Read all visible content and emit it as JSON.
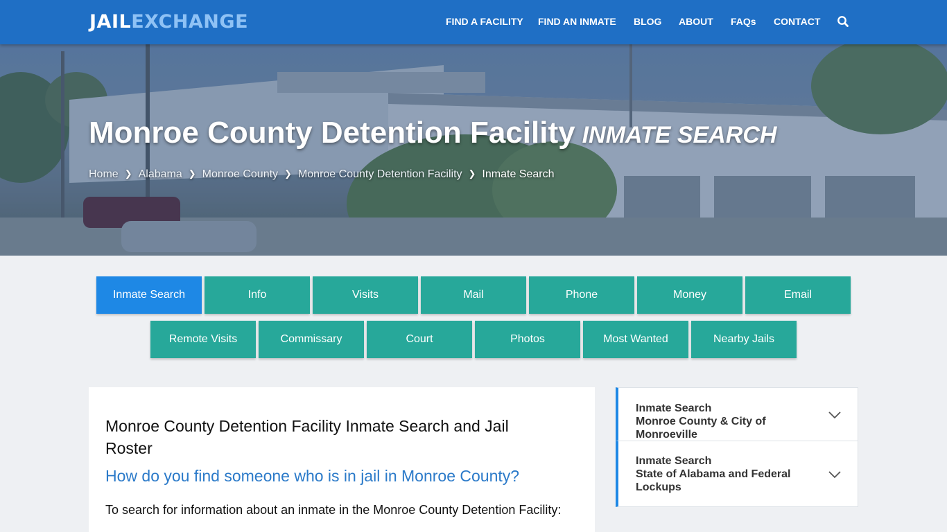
{
  "header": {
    "logo_part1": "JAIL",
    "logo_part2": "EXCHANGE",
    "nav": [
      "FIND A FACILITY",
      "FIND AN INMATE",
      "BLOG",
      "ABOUT",
      "FAQs",
      "CONTACT"
    ],
    "search_icon": "search-icon"
  },
  "hero": {
    "title": "Monroe County Detention Facility",
    "subtitle": "INMATE SEARCH",
    "breadcrumb": [
      "Home",
      "Alabama",
      "Monroe County",
      "Monroe County Detention Facility"
    ],
    "breadcrumb_current": "Inmate Search"
  },
  "tabs": {
    "row1": [
      "Inmate Search",
      "Info",
      "Visits",
      "Mail",
      "Phone",
      "Money",
      "Email"
    ],
    "row2": [
      "Remote Visits",
      "Commissary",
      "Court",
      "Photos",
      "Most Wanted",
      "Nearby Jails"
    ],
    "active": "Inmate Search"
  },
  "content": {
    "heading": "Monroe County Detention Facility Inmate Search and Jail Roster",
    "question": "How do you find someone who is in jail in Monroe County?",
    "intro": "To search for information about an inmate in the Monroe County Detention Facility:"
  },
  "sidebar": {
    "items": [
      {
        "line1": "Inmate Search",
        "line2": "Monroe County & City of Monroeville"
      },
      {
        "line1": "Inmate Search",
        "line2": "State of Alabama and Federal Lockups"
      }
    ]
  },
  "colors": {
    "header_bg": "#1f6fc5",
    "logo_accent": "#8fc2f5",
    "tab_bg": "#27a89a",
    "tab_active": "#1e88e5",
    "link_blue": "#2b7ac9",
    "page_bg": "#eef0f3"
  }
}
